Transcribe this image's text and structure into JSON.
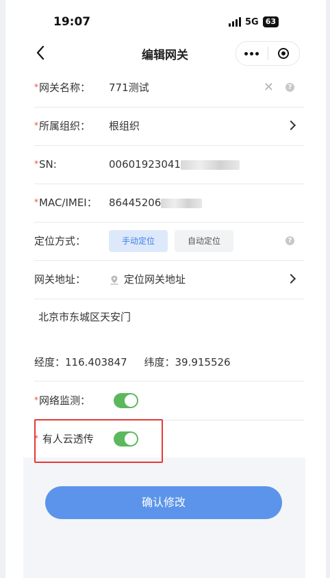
{
  "status_bar": {
    "time": "19:07",
    "network": "5G",
    "battery": "63"
  },
  "nav": {
    "title": "编辑网关"
  },
  "form": {
    "gateway_name": {
      "label": "网关名称：",
      "value": "771测试"
    },
    "org": {
      "label": "所属组织：",
      "value": "根组织"
    },
    "sn": {
      "label": "SN:",
      "value": "00601923041"
    },
    "mac": {
      "label": "MAC/IMEI：",
      "value": "86445206"
    },
    "location_mode": {
      "label": "定位方式：",
      "options": [
        "手动定位",
        "自动定位"
      ],
      "selected": "手动定位"
    },
    "gateway_address": {
      "label": "网关地址：",
      "value": "定位网关地址"
    },
    "address_text": "北京市东城区天安门",
    "longitude": {
      "label": "经度：",
      "value": "116.403847"
    },
    "latitude": {
      "label": "纬度：",
      "value": "39.915526"
    },
    "network_monitor": {
      "label": "网络监测：",
      "enabled": true
    },
    "cloud_passthrough": {
      "label": "有人云透传",
      "enabled": true
    }
  },
  "confirm_label": "确认修改",
  "colors": {
    "primary": "#5b94ea",
    "toggle_on": "#5cb85c",
    "required": "#e74c3c",
    "highlight": "#e53935"
  }
}
